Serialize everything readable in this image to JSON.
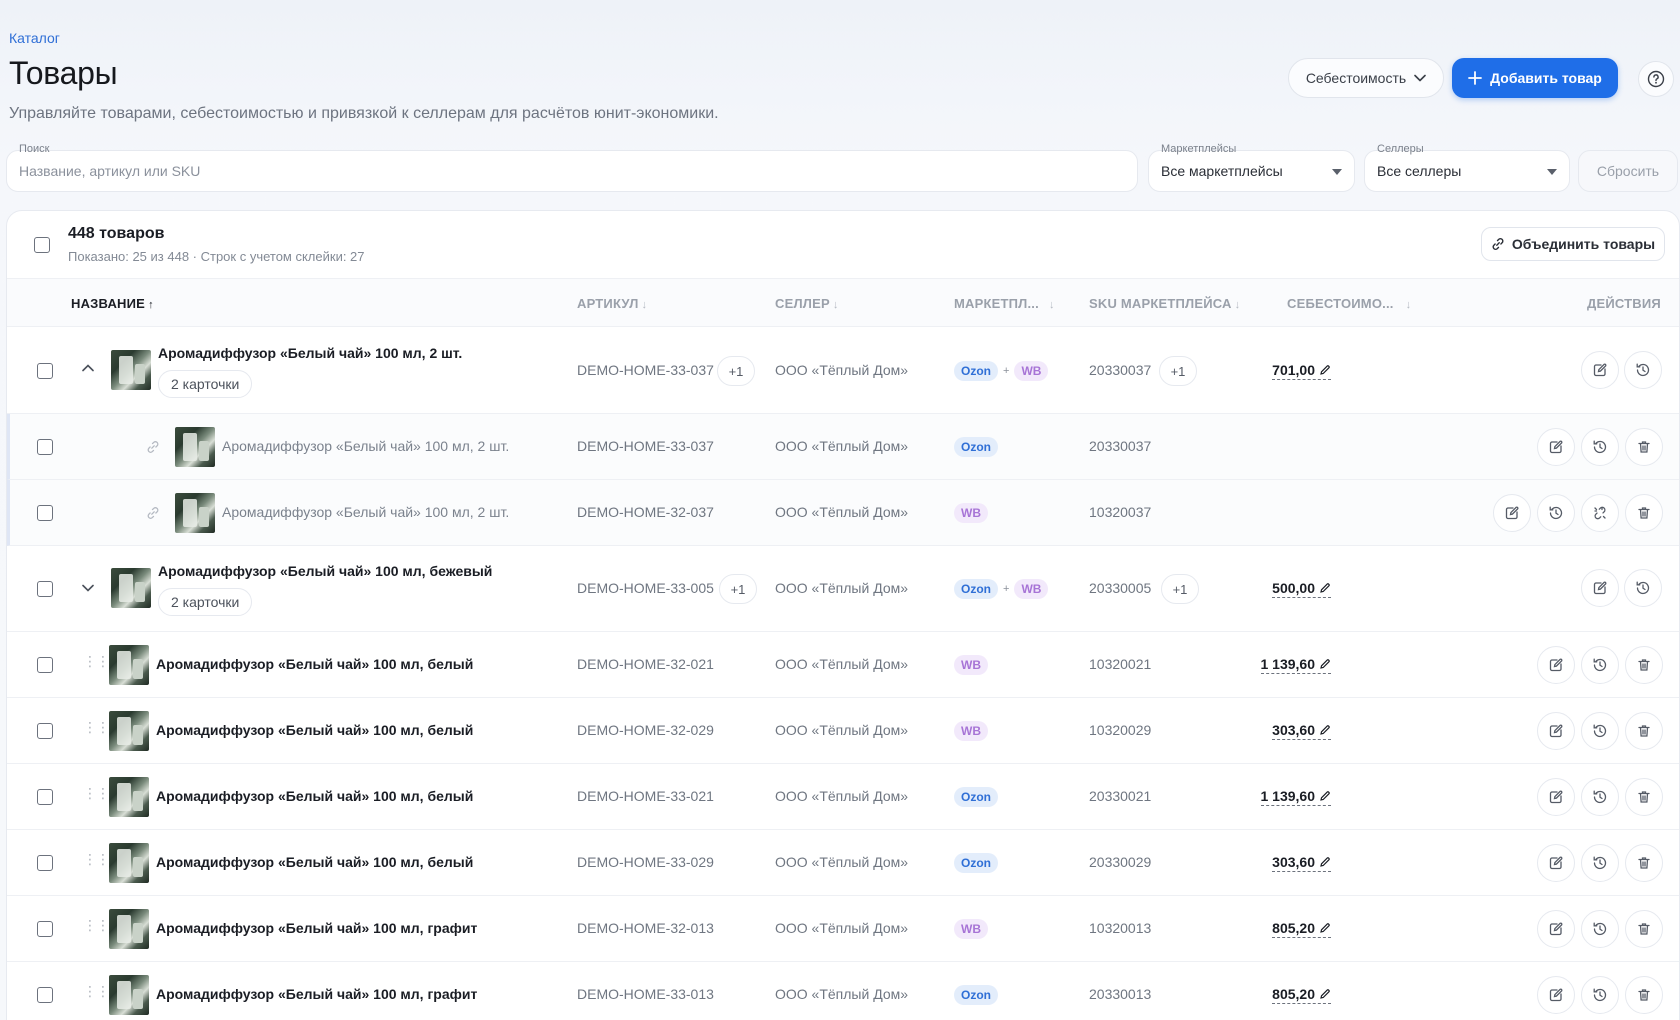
{
  "breadcrumb": "Каталог",
  "page_title": "Товары",
  "subtitle": "Управляйте товарами, себестоимостью и привязкой к селлерам для расчётов юнит-экономики.",
  "header": {
    "cost_dropdown": "Себестоимость",
    "add_button": "Добавить товар"
  },
  "filters": {
    "search_label": "Поиск",
    "search_placeholder": "Название, артикул или SKU",
    "marketplaces_label": "Маркетплейсы",
    "marketplaces_value": "Все маркетплейсы",
    "sellers_label": "Селлеры",
    "sellers_value": "Все селлеры",
    "reset_button": "Сбросить"
  },
  "summary": {
    "count": "448 товаров",
    "shown": "Показано: 25 из 448 · Строк с учетом склейки: 27",
    "merge_button": "Объединить товары"
  },
  "columns": {
    "name": "НАЗВАНИЕ",
    "article": "АРТИКУЛ",
    "seller": "СЕЛЛЕР",
    "marketplace": "МАРКЕТПЛ...",
    "sku": "SKU МАРКЕТПЛЕЙСА",
    "cost": "СЕБЕСТОИМО...",
    "actions": "ДЕЙСТВИЯ"
  },
  "rows": [
    {
      "name": "Аромадиффузор «Белый чай» 100 мл, 2 шт.",
      "chip": "2 карточки",
      "article": "DEMO-HOME-33-037",
      "article_plus": "+1",
      "seller": "ООО «Тёплый Дом»",
      "mp1": "Ozon",
      "mp2": "WB",
      "sku": "20330037",
      "sku_plus": "+1",
      "cost": "701,00"
    },
    {
      "name": "Аромадиффузор «Белый чай» 100 мл, 2 шт.",
      "article": "DEMO-HOME-33-037",
      "seller": "ООО «Тёплый Дом»",
      "mp1": "Ozon",
      "sku": "20330037"
    },
    {
      "name": "Аромадиффузор «Белый чай» 100 мл, 2 шт.",
      "article": "DEMO-HOME-32-037",
      "seller": "ООО «Тёплый Дом»",
      "mp1": "WB",
      "sku": "10320037"
    },
    {
      "name": "Аромадиффузор «Белый чай» 100 мл, бежевый",
      "chip": "2 карточки",
      "article": "DEMO-HOME-33-005",
      "article_plus": "+1",
      "seller": "ООО «Тёплый Дом»",
      "mp1": "Ozon",
      "mp2": "WB",
      "sku": "20330005",
      "sku_plus": "+1",
      "cost": "500,00"
    },
    {
      "name": "Аромадиффузор «Белый чай» 100 мл, белый",
      "article": "DEMO-HOME-32-021",
      "seller": "ООО «Тёплый Дом»",
      "mp1": "WB",
      "sku": "10320021",
      "cost": "1 139,60"
    },
    {
      "name": "Аромадиффузор «Белый чай» 100 мл, белый",
      "article": "DEMO-HOME-32-029",
      "seller": "ООО «Тёплый Дом»",
      "mp1": "WB",
      "sku": "10320029",
      "cost": "303,60"
    },
    {
      "name": "Аромадиффузор «Белый чай» 100 мл, белый",
      "article": "DEMO-HOME-33-021",
      "seller": "ООО «Тёплый Дом»",
      "mp1": "Ozon",
      "sku": "20330021",
      "cost": "1 139,60"
    },
    {
      "name": "Аромадиффузор «Белый чай» 100 мл, белый",
      "article": "DEMO-HOME-33-029",
      "seller": "ООО «Тёплый Дом»",
      "mp1": "Ozon",
      "sku": "20330029",
      "cost": "303,60"
    },
    {
      "name": "Аромадиффузор «Белый чай» 100 мл, графит",
      "article": "DEMO-HOME-32-013",
      "seller": "ООО «Тёплый Дом»",
      "mp1": "WB",
      "sku": "10320013",
      "cost": "805,20"
    },
    {
      "name": "Аромадиффузор «Белый чай» 100 мл, графит",
      "article": "DEMO-HOME-33-013",
      "seller": "ООО «Тёплый Дом»",
      "mp1": "Ozon",
      "sku": "20330013",
      "cost": "805,20"
    }
  ],
  "colors": {
    "accent": "#1f6ee8",
    "ozon": "#2f6fd6",
    "wb": "#a774d6"
  }
}
